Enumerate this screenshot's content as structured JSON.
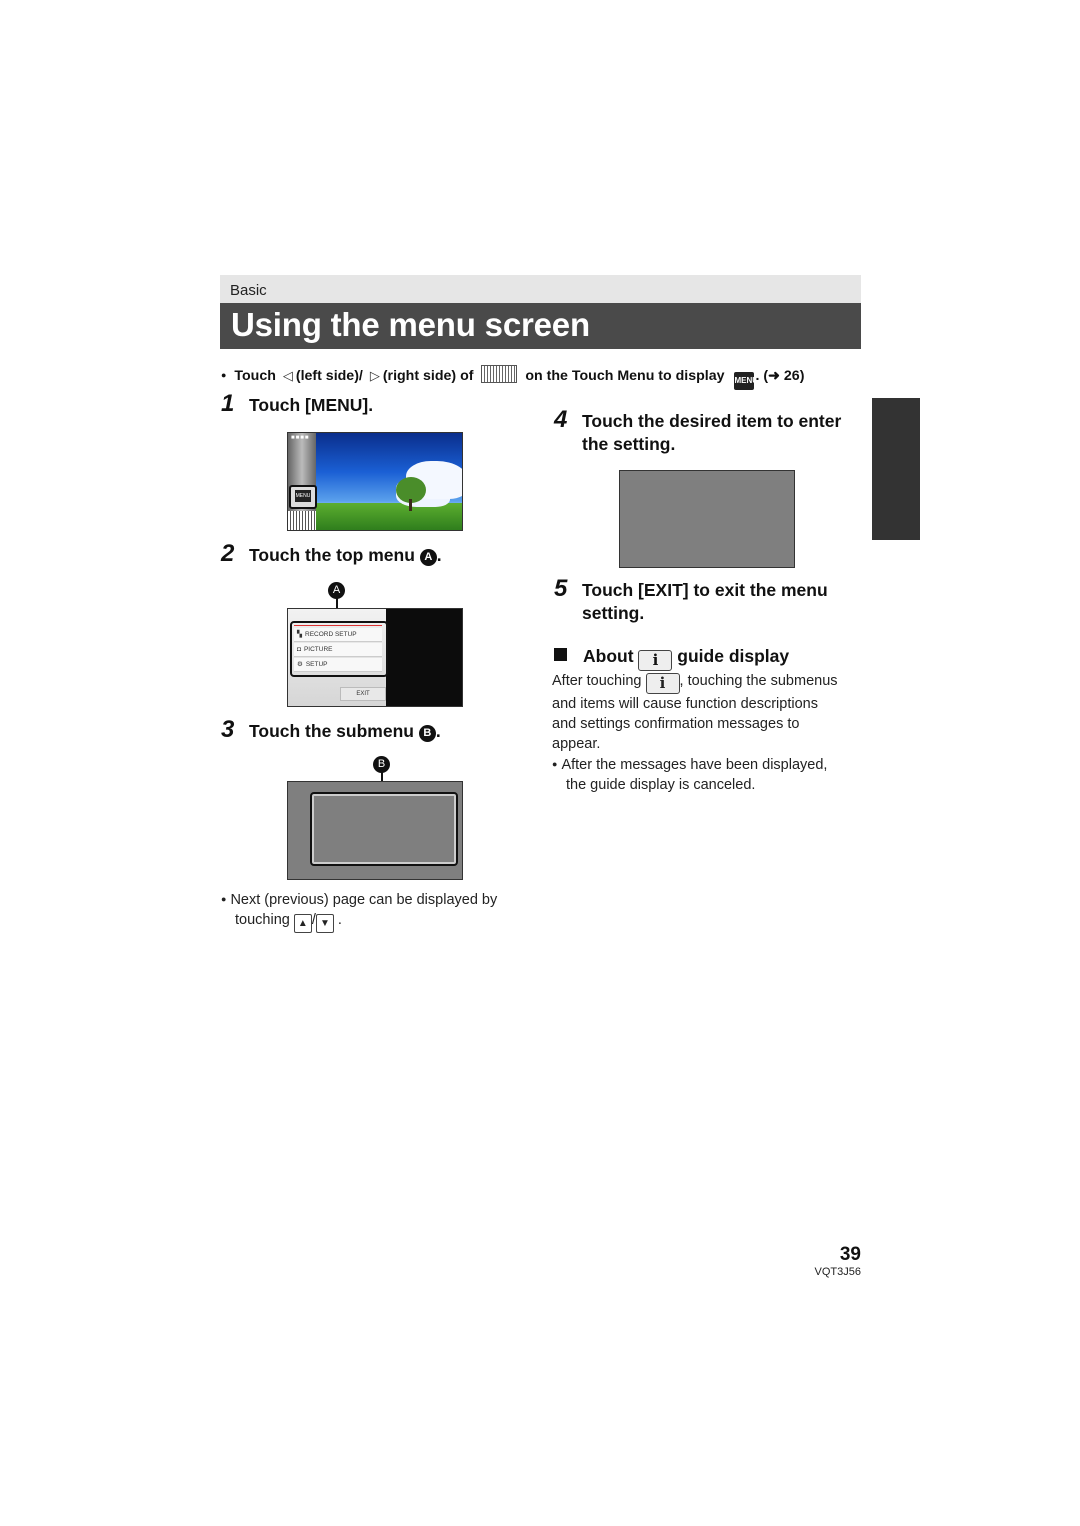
{
  "section": "Basic",
  "title": "Using the menu screen",
  "intro": {
    "touch": "Touch",
    "left_icon": "◁",
    "left_text": "(left side)/",
    "right_icon": "▷",
    "right_text": "(right side) of",
    "tail": "on the Touch Menu to display",
    "menu_icon_label": "MENU",
    "ref": ". (➜ 26)"
  },
  "steps": [
    {
      "num": "1",
      "text": "Touch [MENU]."
    },
    {
      "num": "2",
      "text": "Touch the top menu",
      "marker": "A",
      "end": "."
    },
    {
      "num": "3",
      "text": "Touch the submenu",
      "marker": "B",
      "end": "."
    },
    {
      "num": "4",
      "text_line1": "Touch the desired item to enter",
      "text_line2": "the setting."
    },
    {
      "num": "5",
      "text_line1": "Touch [EXIT] to exit the menu",
      "text_line2": "setting."
    }
  ],
  "screen1": {
    "menu_button": "MENU",
    "dots": "■■■■"
  },
  "screen2": {
    "marker": "A",
    "items": [
      {
        "icon": "camcorder-icon",
        "glyph": "▚",
        "label": "RECORD SETUP"
      },
      {
        "icon": "camera-icon",
        "glyph": "◘",
        "label": "PICTURE"
      },
      {
        "icon": "setup-icon",
        "glyph": "⚙",
        "label": "SETUP"
      }
    ],
    "exit": "EXIT"
  },
  "screen3": {
    "marker": "B"
  },
  "note_pages": {
    "line1": "Next (previous) page can be displayed by",
    "line2": "touching",
    "up": "▲",
    "slash": "/",
    "down": "▼",
    "end": "."
  },
  "guide": {
    "heading_pre": "About",
    "heading_post": "guide display",
    "info_icon": "i",
    "para_l1_pre": "After touching",
    "para_l1_post": ", touching the submenus",
    "para_l2": "and items will cause function descriptions",
    "para_l3": "and settings confirmation messages to",
    "para_l4": "appear.",
    "bullet_l1": "After the messages have been displayed,",
    "bullet_l2": "the guide display is canceled."
  },
  "footer": {
    "page_number": "39",
    "code": "VQT3J56"
  }
}
